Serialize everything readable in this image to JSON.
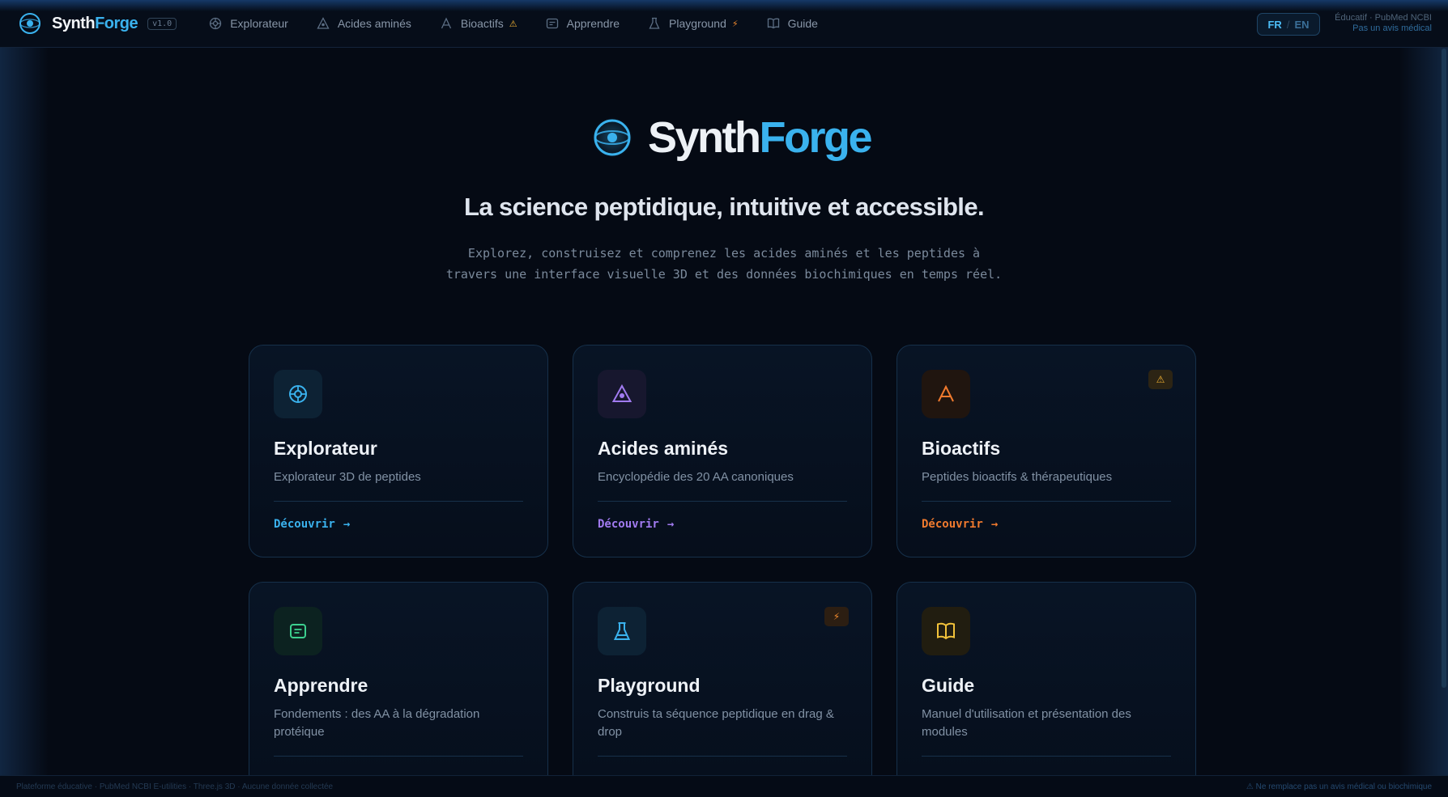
{
  "nav": {
    "brand_a": "Synth",
    "brand_b": "Forge",
    "version": "v1.0",
    "items": [
      {
        "label": "Explorateur",
        "icon": "target-icon",
        "tag": ""
      },
      {
        "label": "Acides aminés",
        "icon": "triangle-atom-icon",
        "tag": ""
      },
      {
        "label": "Bioactifs",
        "icon": "peak-icon",
        "tag": "⚠"
      },
      {
        "label": "Apprendre",
        "icon": "note-icon",
        "tag": ""
      },
      {
        "label": "Playground",
        "icon": "flask-icon",
        "tag": "⚡"
      },
      {
        "label": "Guide",
        "icon": "book-icon",
        "tag": ""
      }
    ],
    "lang_fr": "FR",
    "lang_sep": "/",
    "lang_en": "EN",
    "note_line1": "Éducatif · PubMed NCBI",
    "note_line2": "Pas un avis médical"
  },
  "hero": {
    "title_a": "Synth",
    "title_b": "Forge",
    "tagline": "La science peptidique, intuitive et accessible.",
    "desc_line1": "Explorez, construisez et comprenez les acides aminés et les peptides à",
    "desc_line2": "travers une interface visuelle 3D et des données biochimiques en temps réel."
  },
  "cards": [
    {
      "title": "Explorateur",
      "desc": "Explorateur 3D de peptides",
      "cta": "Découvrir",
      "badge": "",
      "accent": "#3ab2ee"
    },
    {
      "title": "Acides aminés",
      "desc": "Encyclopédie des 20 AA canoniques",
      "cta": "Découvrir",
      "badge": "",
      "accent": "#a17bf0"
    },
    {
      "title": "Bioactifs",
      "desc": "Peptides bioactifs & thérapeutiques",
      "cta": "Découvrir",
      "badge": "⚠",
      "accent": "#f07a2e"
    },
    {
      "title": "Apprendre",
      "desc": "Fondements : des AA à la dégradation protéique",
      "cta": "",
      "badge": "",
      "accent": "#3ccf8e"
    },
    {
      "title": "Playground",
      "desc": "Construis ta séquence peptidique en drag & drop",
      "cta": "",
      "badge": "⚡",
      "accent": "#3ab2ee"
    },
    {
      "title": "Guide",
      "desc": "Manuel d'utilisation et présentation des modules",
      "cta": "",
      "badge": "",
      "accent": "#f2c23a"
    }
  ],
  "footer": {
    "left": "Plateforme éducative · PubMed NCBI E-utilities · Three.js 3D · Aucune donnée collectée",
    "right": "⚠ Ne remplace pas un avis médical ou biochimique"
  }
}
